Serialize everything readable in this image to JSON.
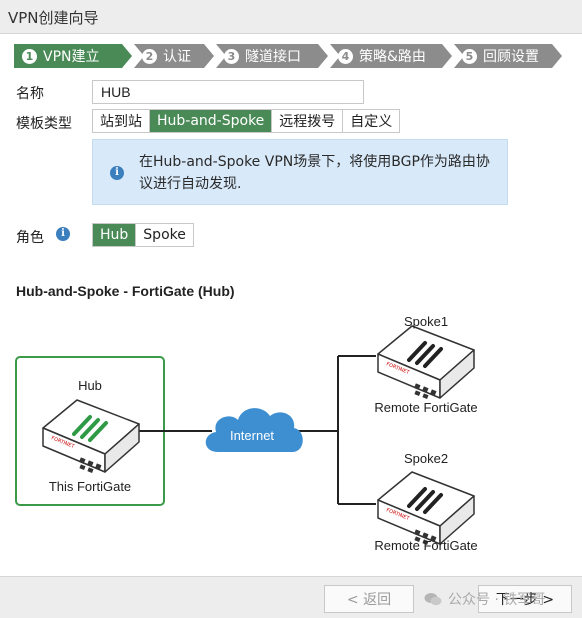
{
  "window": {
    "title": "VPN创建向导"
  },
  "steps": [
    {
      "num": "1",
      "label": "VPN建立",
      "active": true
    },
    {
      "num": "2",
      "label": "认证",
      "active": false
    },
    {
      "num": "3",
      "label": "隧道接口",
      "active": false
    },
    {
      "num": "4",
      "label": "策略&路由",
      "active": false
    },
    {
      "num": "5",
      "label": "回顾设置",
      "active": false
    }
  ],
  "form": {
    "name_label": "名称",
    "name_value": "HUB",
    "template_label": "模板类型",
    "template_options": [
      "站到站",
      "Hub-and-Spoke",
      "远程拨号",
      "自定义"
    ],
    "template_selected": "Hub-and-Spoke",
    "info_text": "在Hub-and-Spoke VPN场景下，将使用BGP作为路由协议进行自动发现.",
    "role_label": "角色",
    "role_options": [
      "Hub",
      "Spoke"
    ],
    "role_selected": "Hub"
  },
  "diagram": {
    "title": "Hub-and-Spoke - FortiGate (Hub)",
    "hub_label": "Hub",
    "hub_caption": "This FortiGate",
    "internet_label": "Internet",
    "spoke1_label": "Spoke1",
    "spoke1_caption": "Remote FortiGate",
    "spoke2_label": "Spoke2",
    "spoke2_caption": "Remote FortiGate",
    "device_brand": "FORTINET"
  },
  "footer": {
    "back_label": "< 返回",
    "next_label": "下一步 >",
    "watermark": "公众号 · 铁军哥"
  },
  "colors": {
    "accent_green": "#4a8a57",
    "step_inactive": "#8c8c8c",
    "info_bg": "#d8e9f9",
    "cloud_blue": "#3d8fd1"
  }
}
